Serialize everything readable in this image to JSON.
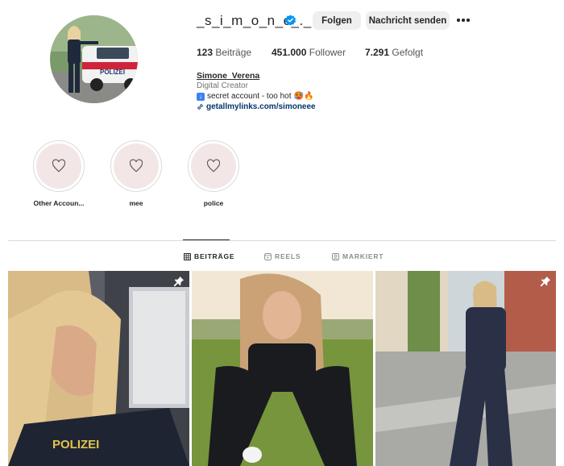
{
  "profile": {
    "username": "_s_i_m_o_n_e_._",
    "verified": true,
    "follow_label": "Folgen",
    "message_label": "Nachricht senden",
    "more_icon": "more-horizontal-icon"
  },
  "stats": {
    "posts_count": "123",
    "posts_label": "Beiträge",
    "followers_count": "451.000",
    "followers_label": "Follower",
    "following_count": "7.291",
    "following_label": "Gefolgt"
  },
  "bio": {
    "name": "Simone_Verena",
    "category": "Digital Creator",
    "line": "secret account - too hot",
    "line_emojis": "🥵🔥",
    "link": "getallmylinks.com/simoneee"
  },
  "highlights": [
    {
      "label": "Other Accoun..."
    },
    {
      "label": "mee"
    },
    {
      "label": "police"
    }
  ],
  "tabs": [
    {
      "label": "BEITRÄGE",
      "active": true
    },
    {
      "label": "REELS",
      "active": false
    },
    {
      "label": "MARKIERT",
      "active": false
    }
  ],
  "posts": [
    {
      "pinned": true,
      "overlay_text": "POLIZEI"
    },
    {
      "pinned": false
    },
    {
      "pinned": true
    }
  ],
  "colors": {
    "verified": "#0095f6",
    "link": "#00376b",
    "button_bg": "#efefef",
    "highlight_bg": "#f3e6e6"
  }
}
